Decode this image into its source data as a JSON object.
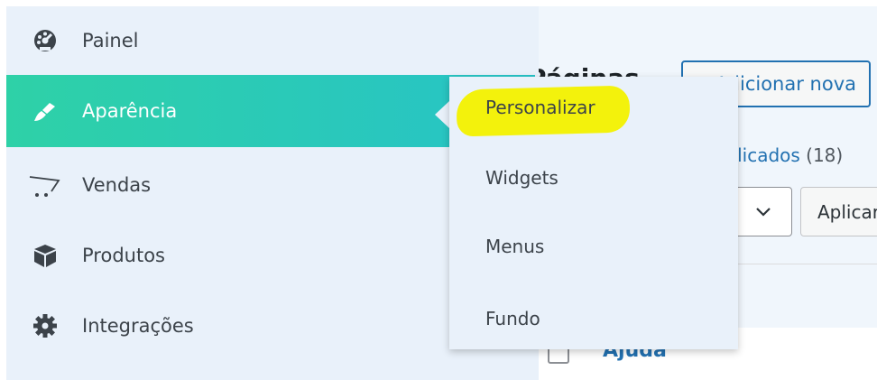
{
  "sidebar": {
    "items": [
      {
        "label": "Painel",
        "icon": "dashboard-icon"
      },
      {
        "label": "Aparência",
        "icon": "paintbrush-icon",
        "active": true
      },
      {
        "label": "Vendas",
        "icon": "cart-icon"
      },
      {
        "label": "Produtos",
        "icon": "box-icon"
      },
      {
        "label": "Integrações",
        "icon": "gear-icon"
      }
    ]
  },
  "flyout": {
    "items": [
      {
        "label": "Personalizar",
        "highlighted": true
      },
      {
        "label": "Widgets"
      },
      {
        "label": "Menus"
      },
      {
        "label": "Fundo"
      }
    ]
  },
  "content": {
    "page_title": "Páginas",
    "add_new_label": "Adicionar nova",
    "count_link_label": "Publicados",
    "count_link_number": "(18)",
    "apply_label": "Aplicar",
    "row_title": "Ajuda"
  },
  "colors": {
    "active_gradient_start": "#2ed1a7",
    "active_gradient_end": "#27c3c7",
    "sidebar_bg": "#e9f1fa",
    "highlight": "#f3f20c",
    "link": "#2271b1"
  }
}
